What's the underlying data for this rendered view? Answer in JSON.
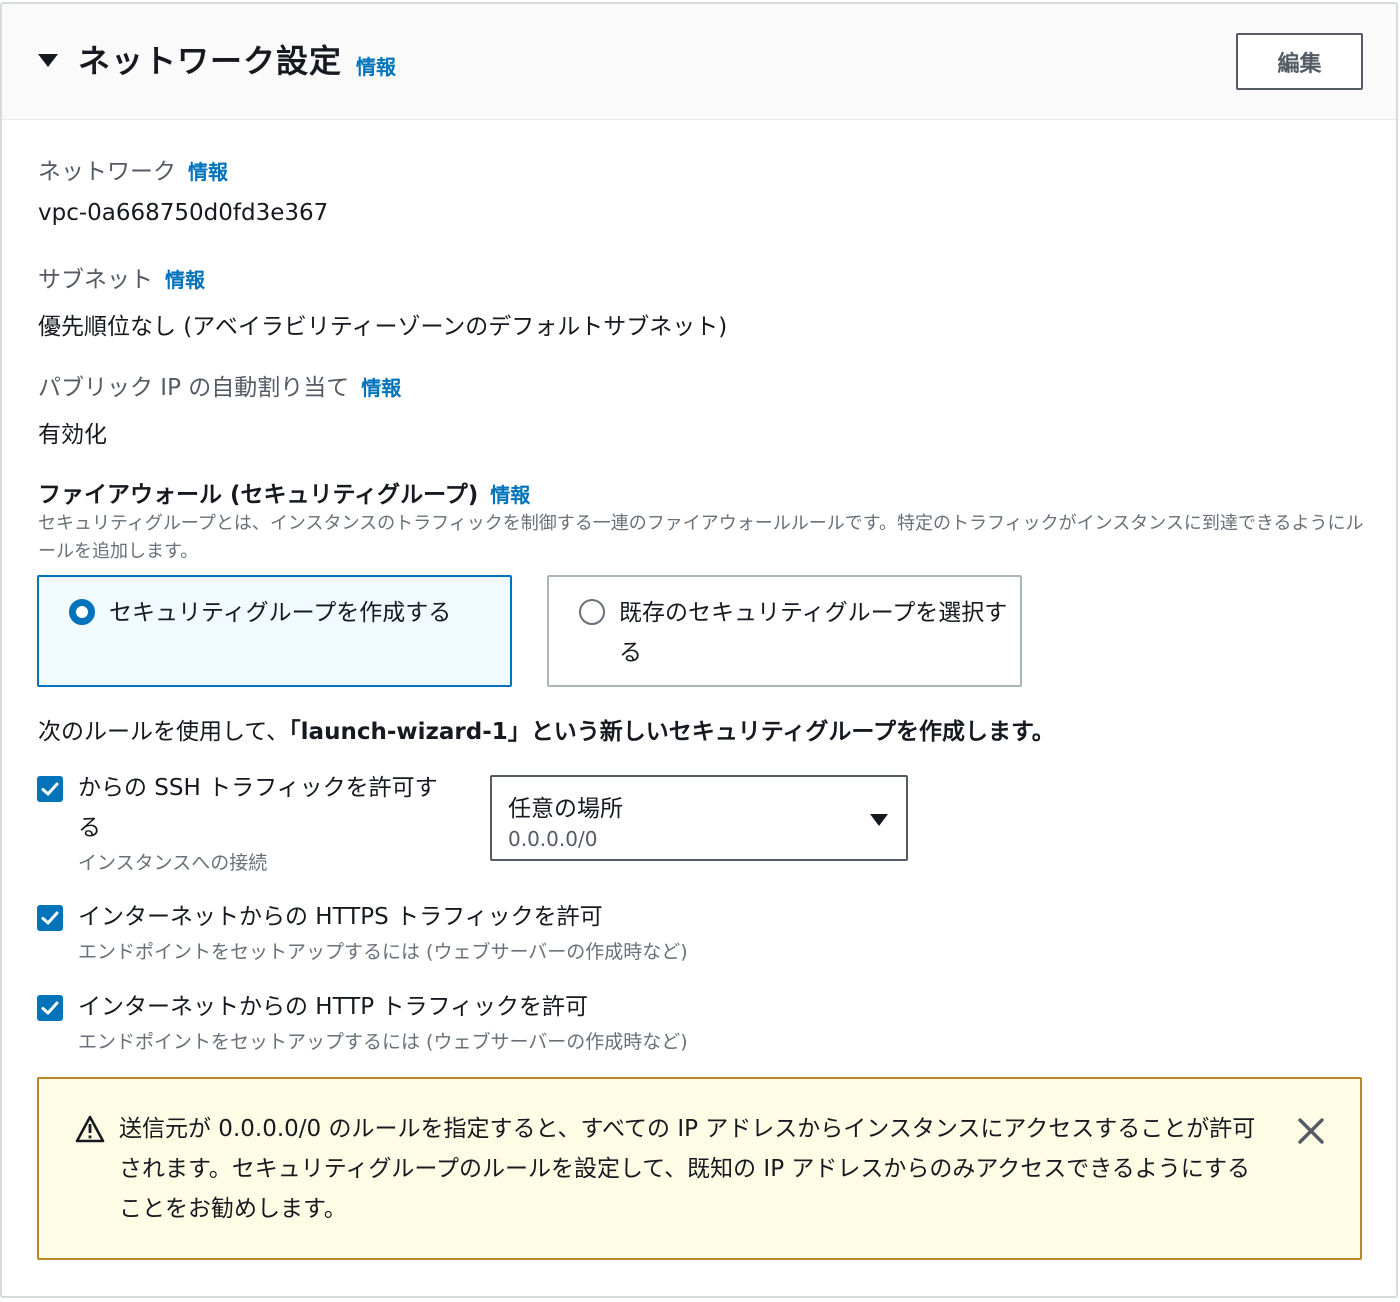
{
  "header": {
    "title": "ネットワーク設定",
    "info_label": "情報",
    "edit_label": "編集"
  },
  "network": {
    "label": "ネットワーク",
    "info_label": "情報",
    "value": "vpc-0a668750d0fd3e367"
  },
  "subnet": {
    "label": "サブネット",
    "info_label": "情報",
    "value": "優先順位なし (アベイラビリティーゾーンのデフォルトサブネット)"
  },
  "public_ip": {
    "label": "パブリック IP の自動割り当て",
    "info_label": "情報",
    "value": "有効化"
  },
  "firewall": {
    "title": "ファイアウォール (セキュリティグループ)",
    "info_label": "情報",
    "description": "セキュリティグループとは、インスタンスのトラフィックを制御する一連のファイアウォールルールです。特定のトラフィックがインスタンスに到達できるようにルールを追加します。",
    "options": [
      {
        "label": "セキュリティグループを作成する",
        "selected": true
      },
      {
        "label": "既存のセキュリティグループを選択する",
        "selected": false
      }
    ],
    "statement_prefix": "次のルールを使用して、",
    "statement_group": "「launch-wizard-1」",
    "statement_suffix": "という新しいセキュリティグループを作成します。"
  },
  "rules": {
    "ssh": {
      "label": "からの SSH トラフィックを許可する",
      "sub": "インスタンスへの接続",
      "checked": true,
      "source_select": {
        "value": "任意の場所",
        "sub_value": "0.0.0.0/0"
      }
    },
    "https": {
      "label": "インターネットからの HTTPS トラフィックを許可",
      "sub": "エンドポイントをセットアップするには (ウェブサーバーの作成時など)",
      "checked": true
    },
    "http": {
      "label": "インターネットからの HTTP トラフィックを許可",
      "sub": "エンドポイントをセットアップするには (ウェブサーバーの作成時など)",
      "checked": true
    }
  },
  "warning": {
    "text": "送信元が 0.0.0.0/0 のルールを指定すると、すべての IP アドレスからインスタンスにアクセスすることが許可されます。セキュリティグループのルールを設定して、既知の IP アドレスからのみアクセスできるようにすることをお勧めします。",
    "icon": "warning-triangle-icon",
    "close_icon": "close-icon"
  },
  "colors": {
    "accent": "#0073bb",
    "warning_border": "#b8862b",
    "warning_bg": "#fffce6"
  }
}
